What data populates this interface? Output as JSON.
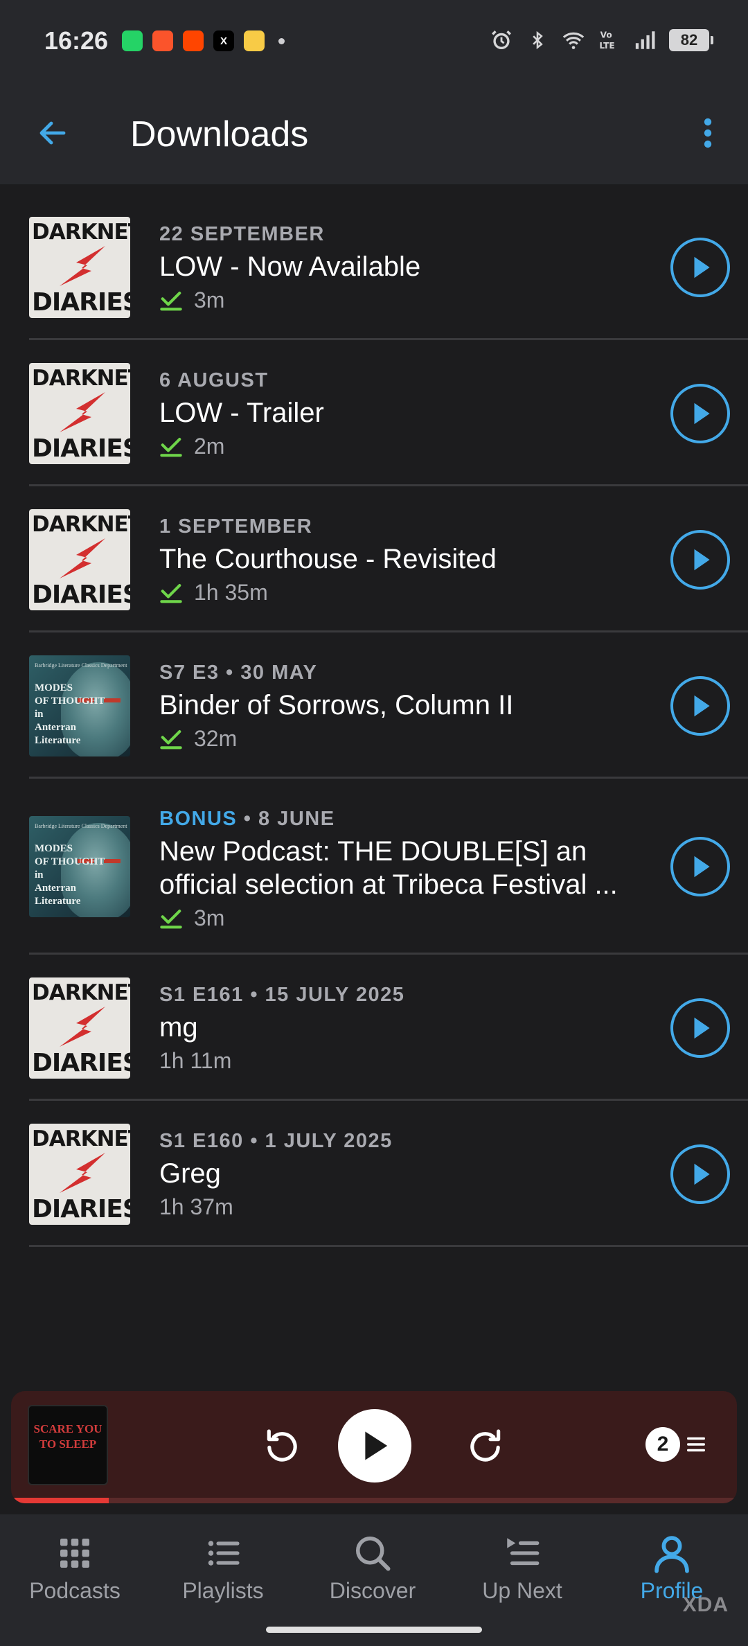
{
  "status_bar": {
    "time": "16:26",
    "battery": "82",
    "app_icons": [
      {
        "name": "whatsapp-icon",
        "color": "#25d366",
        "glyph": ""
      },
      {
        "name": "brave-icon",
        "color": "#fb542b",
        "glyph": ""
      },
      {
        "name": "reddit-icon",
        "color": "#ff4500",
        "glyph": ""
      },
      {
        "name": "x-icon",
        "color": "#000000",
        "glyph": "X"
      },
      {
        "name": "blinkit-icon",
        "color": "#f8cb46",
        "glyph": ""
      }
    ]
  },
  "header": {
    "title": "Downloads"
  },
  "episodes": [
    {
      "date": "22 SEPTEMBER",
      "bonus": "",
      "title": "LOW - Now Available",
      "duration": "3m",
      "downloaded": true,
      "art": "darknet"
    },
    {
      "date": "6 AUGUST",
      "bonus": "",
      "title": "LOW - Trailer",
      "duration": "2m",
      "downloaded": true,
      "art": "darknet"
    },
    {
      "date": "1 SEPTEMBER",
      "bonus": "",
      "title": "The Courthouse - Revisited",
      "duration": "1h 35m",
      "downloaded": true,
      "art": "darknet"
    },
    {
      "date": "S7 E3 • 30 MAY",
      "bonus": "",
      "title": "Binder of Sorrows, Column II",
      "duration": "32m",
      "downloaded": true,
      "art": "modes"
    },
    {
      "date": " • 8 JUNE",
      "bonus": "BONUS",
      "title": "New Podcast: THE DOUBLE[S] an official selection at Tribeca Festival ...",
      "duration": "3m",
      "downloaded": true,
      "art": "modes"
    },
    {
      "date": "S1 E161 • 15 JULY 2025",
      "bonus": "",
      "title": "mg",
      "duration": "1h 11m",
      "downloaded": false,
      "art": "darknet"
    },
    {
      "date": "S1 E160 • 1 JULY 2025",
      "bonus": "",
      "title": "Greg",
      "duration": "1h 37m",
      "downloaded": false,
      "art": "darknet"
    }
  ],
  "artwork": {
    "darknet_top": "DARKNET",
    "darknet_bottom": "DIARIES",
    "modes_small": "Barbridge Literature Classics Department",
    "modes_lines": [
      "MODES",
      "OF THOUGHT",
      "in",
      "Anterran",
      "Literature"
    ]
  },
  "mini_player": {
    "art_text": "SCARE YOU TO SLEEP",
    "queue_count": "2",
    "progress": 0.135
  },
  "bottom_nav": [
    {
      "label": "Podcasts",
      "icon": "grid-icon",
      "active": false
    },
    {
      "label": "Playlists",
      "icon": "list-icon",
      "active": false
    },
    {
      "label": "Discover",
      "icon": "search-icon",
      "active": false
    },
    {
      "label": "Up Next",
      "icon": "up-next-icon",
      "active": false
    },
    {
      "label": "Profile",
      "icon": "profile-icon",
      "active": true
    }
  ],
  "colors": {
    "accent": "#43a9e8",
    "check": "#6fd64a",
    "player_bg": "#3a1b1b",
    "progress": "#e53935"
  },
  "watermark": "XDA"
}
